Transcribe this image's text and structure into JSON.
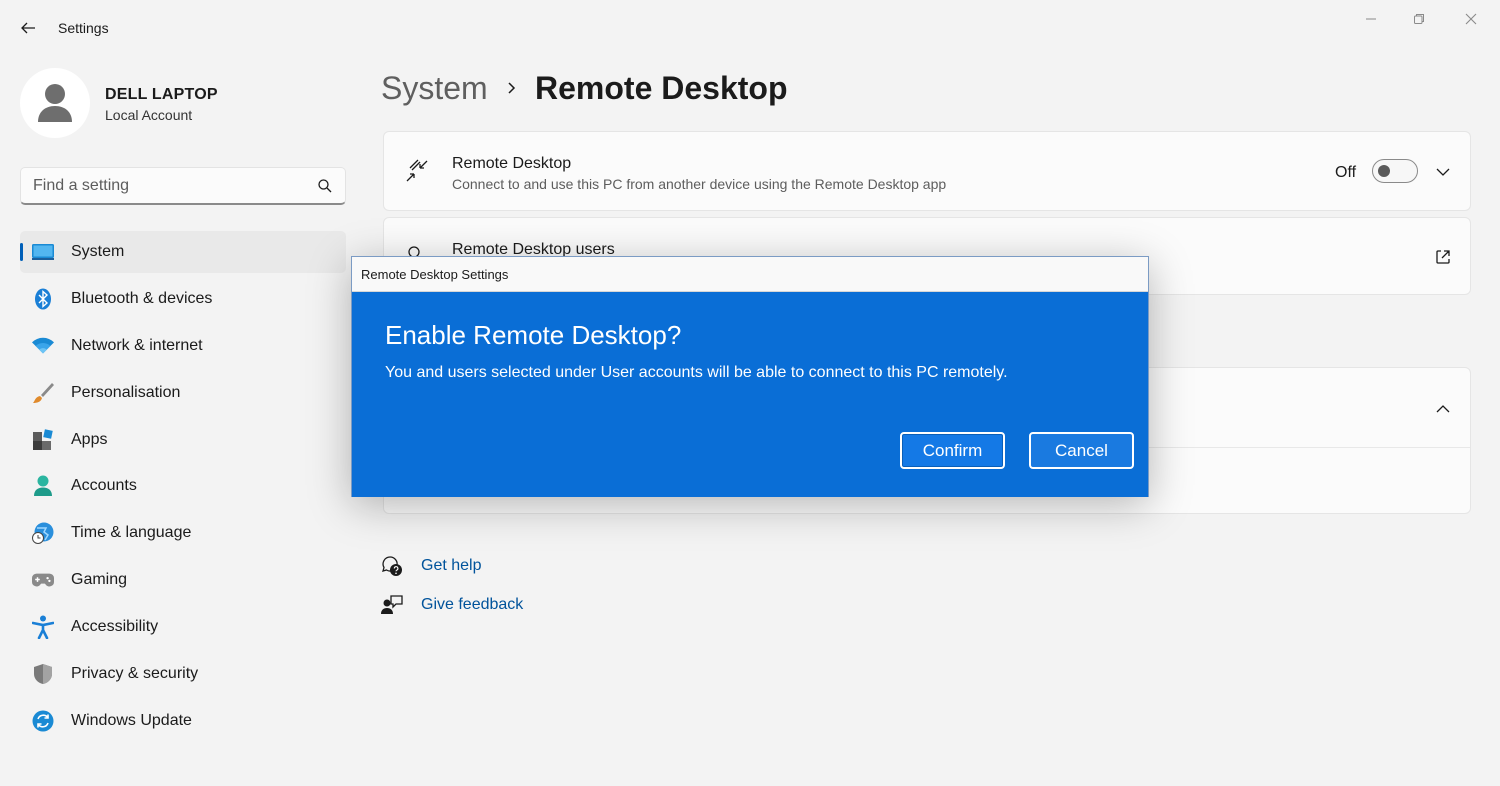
{
  "window": {
    "title": "Settings"
  },
  "profile": {
    "name": "DELL LAPTOP",
    "account_type": "Local Account"
  },
  "search": {
    "placeholder": "Find a setting"
  },
  "nav": {
    "items": [
      {
        "label": "System",
        "icon": "system-monitor-icon",
        "active": true
      },
      {
        "label": "Bluetooth & devices",
        "icon": "bluetooth-icon"
      },
      {
        "label": "Network & internet",
        "icon": "wifi-icon"
      },
      {
        "label": "Personalisation",
        "icon": "paintbrush-icon"
      },
      {
        "label": "Apps",
        "icon": "apps-icon"
      },
      {
        "label": "Accounts",
        "icon": "person-icon"
      },
      {
        "label": "Time & language",
        "icon": "globe-clock-icon"
      },
      {
        "label": "Gaming",
        "icon": "gamepad-icon"
      },
      {
        "label": "Accessibility",
        "icon": "accessibility-icon"
      },
      {
        "label": "Privacy & security",
        "icon": "shield-icon"
      },
      {
        "label": "Windows Update",
        "icon": "update-icon"
      }
    ]
  },
  "breadcrumb": {
    "parent": "System",
    "current": "Remote Desktop"
  },
  "cards": {
    "remote_desktop": {
      "title": "Remote Desktop",
      "description": "Connect to and use this PC from another device using the Remote Desktop app",
      "toggle_label": "Off",
      "toggle_on": false
    },
    "remote_users": {
      "title": "Remote Desktop users"
    }
  },
  "help": {
    "get_help": "Get help",
    "give_feedback": "Give feedback"
  },
  "dialog": {
    "title": "Remote Desktop Settings",
    "heading": "Enable Remote Desktop?",
    "message": "You and users selected under User accounts will be able to connect to this PC remotely.",
    "confirm_label": "Confirm",
    "cancel_label": "Cancel"
  },
  "colors": {
    "accent": "#005fb8",
    "dialog_body": "#0a6ed6",
    "link": "#00539b",
    "background": "#f3f3f3"
  }
}
